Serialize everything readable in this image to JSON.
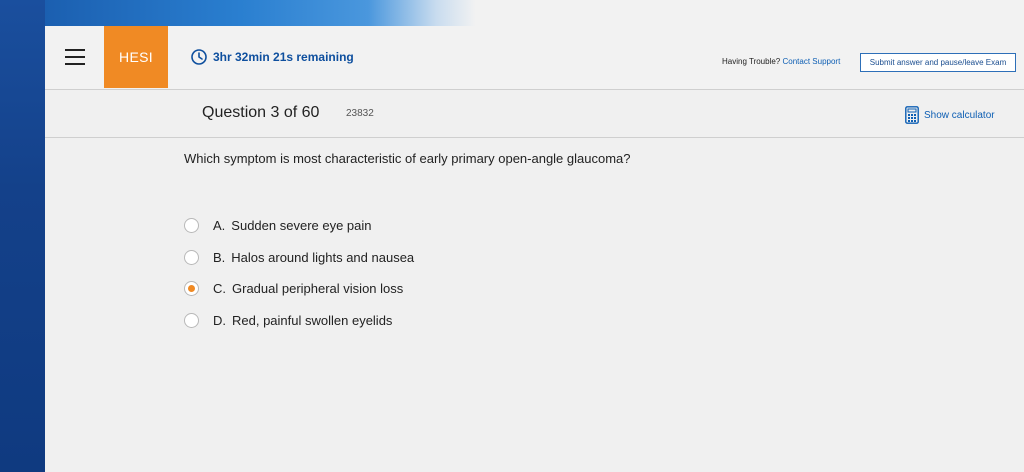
{
  "header": {
    "logo_text": "HESI",
    "timer_text": "3hr 32min 21s remaining",
    "trouble_text": "Having Trouble?",
    "support_link": "Contact Support",
    "submit_label": "Submit answer and pause/leave Exam"
  },
  "question_bar": {
    "title": "Question 3 of 60",
    "id": "23832",
    "calculator_label": "Show calculator"
  },
  "question": {
    "text": "Which symptom is most characteristic of early primary open-angle glaucoma?",
    "options": [
      {
        "letter": "A.",
        "text": "Sudden severe eye pain",
        "selected": false
      },
      {
        "letter": "B.",
        "text": "Halos around lights and nausea",
        "selected": false
      },
      {
        "letter": "C.",
        "text": "Gradual peripheral vision loss",
        "selected": true
      },
      {
        "letter": "D.",
        "text": "Red, painful swollen eyelids",
        "selected": false
      }
    ]
  },
  "colors": {
    "accent_orange": "#f08a24",
    "brand_blue": "#0e4f9e",
    "sidebar_blue": "#14418a"
  },
  "icons": {
    "menu": "hamburger-menu-icon",
    "timer": "clock-icon",
    "calculator": "calculator-icon"
  }
}
